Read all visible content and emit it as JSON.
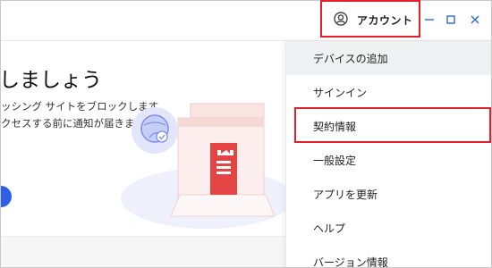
{
  "header": {
    "account_label": "アカウント",
    "icons": [
      "user-circle-icon",
      "minimize-icon",
      "maximize-icon",
      "close-icon"
    ]
  },
  "main": {
    "heading": "しましょう",
    "desc_line1": "ッシング サイトをブロックします",
    "desc_line2": "クセスする前に通知が届きます"
  },
  "menu": {
    "items": [
      {
        "label": "デバイスの追加"
      },
      {
        "label": "サインイン"
      },
      {
        "label": "契約情報"
      },
      {
        "label": "一般設定"
      },
      {
        "label": "アプリを更新"
      },
      {
        "label": "ヘルプ"
      },
      {
        "label": "バージョン情報"
      }
    ]
  },
  "colors": {
    "accent": "#2b6cd9",
    "highlight": "#e0202a",
    "menu_active_bg": "#f0f1f3"
  }
}
